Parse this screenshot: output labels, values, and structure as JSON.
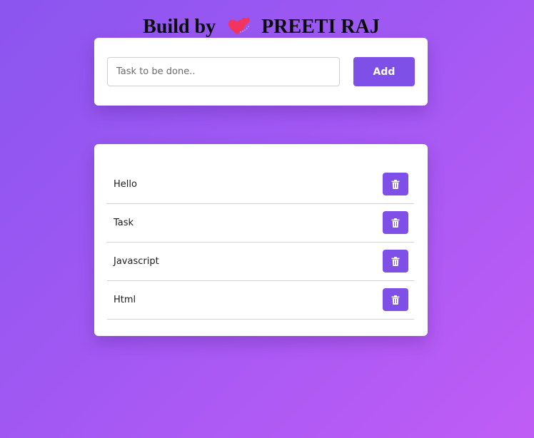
{
  "header": {
    "prefix": "Build by",
    "author": "PREETI RAJ",
    "emoji_icon": "two-hearts-icon"
  },
  "form": {
    "input_value": "",
    "input_placeholder": "Task to be done..",
    "add_label": "Add"
  },
  "tasks": [
    {
      "text": "Hello",
      "delete_icon": "trash-icon"
    },
    {
      "text": "Task",
      "delete_icon": "trash-icon"
    },
    {
      "text": "Javascript",
      "delete_icon": "trash-icon"
    },
    {
      "text": "Html",
      "delete_icon": "trash-icon"
    }
  ],
  "colors": {
    "accent": "#7e50e8",
    "background_start": "#8b55ef",
    "background_end": "#c05cf6",
    "heart": "#f2345e"
  }
}
